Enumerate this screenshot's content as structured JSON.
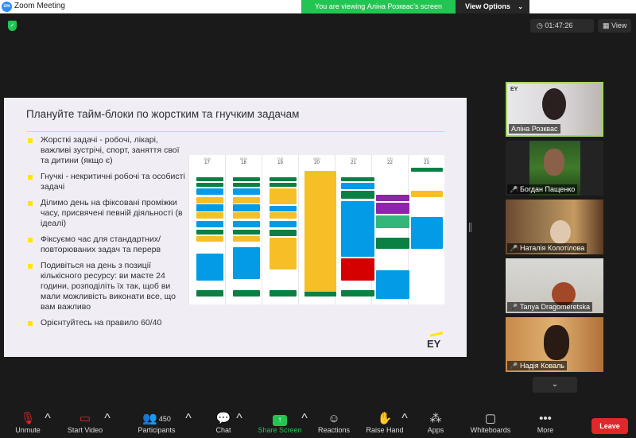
{
  "window": {
    "app_logo": "zm",
    "title": "Zoom Meeting",
    "minimize_icon": "minimize-icon",
    "maximize_icon": "maximize-icon",
    "close_icon": "close-icon"
  },
  "banner": {
    "viewing": "You are viewing Аліна Розквас's screen",
    "view_options": "View Options"
  },
  "header": {
    "timer": "01:47:26",
    "view_label": "View"
  },
  "slide": {
    "title": "Плануйте тайм-блоки по жорстким та гнучким задачам",
    "bullets": [
      "Жорсткі задачі - робочі, лікарі, важливі зустрічі, спорт, заняття свої та дитини (якщо є)",
      "Гнучкі - некритичні робочі та особисті задачі",
      "Ділимо день на фіксовані проміжки часу, присвячені певній діяльності (в ідеалі)",
      "Фіксуємо час для стандартних/повторюваних задач та перерв",
      "Подивіться на день з позиції кількісного ресурсу: ви маєте 24 години, розподіліть їх так, щоб ви мали можливість виконати все, що вам важливо",
      "Орієнтуйтесь на правило 60/40"
    ],
    "logo": "EY",
    "calendar_days": [
      {
        "label": "SUN",
        "num": "17"
      },
      {
        "label": "MON",
        "num": "18"
      },
      {
        "label": "TUE",
        "num": "19"
      },
      {
        "label": "WED",
        "num": "20"
      },
      {
        "label": "THU",
        "num": "21"
      },
      {
        "label": "FRI",
        "num": "22"
      },
      {
        "label": "SAT",
        "num": "23"
      }
    ]
  },
  "participants": [
    {
      "name": "Аліна Розквас",
      "muted": false
    },
    {
      "name": "Богдан Пащенко",
      "muted": true
    },
    {
      "name": "Наталія Колотілова",
      "muted": true
    },
    {
      "name": "Tanya Dragomeretska",
      "muted": true
    },
    {
      "name": "Надія Коваль",
      "muted": true
    }
  ],
  "toolbar": {
    "unmute": "Unmute",
    "start_video": "Start Video",
    "participants": "Participants",
    "participants_count": "450",
    "chat": "Chat",
    "share_screen": "Share Screen",
    "reactions": "Reactions",
    "raise_hand": "Raise Hand",
    "apps": "Apps",
    "whiteboards": "Whiteboards",
    "more": "More",
    "leave": "Leave"
  },
  "colors": {
    "zoom_blue": "#2d8cff",
    "viewing_green": "#23c552",
    "leave_red": "#e02828",
    "active_speaker": "#a4d65e",
    "ey_yellow": "#ffe600"
  }
}
